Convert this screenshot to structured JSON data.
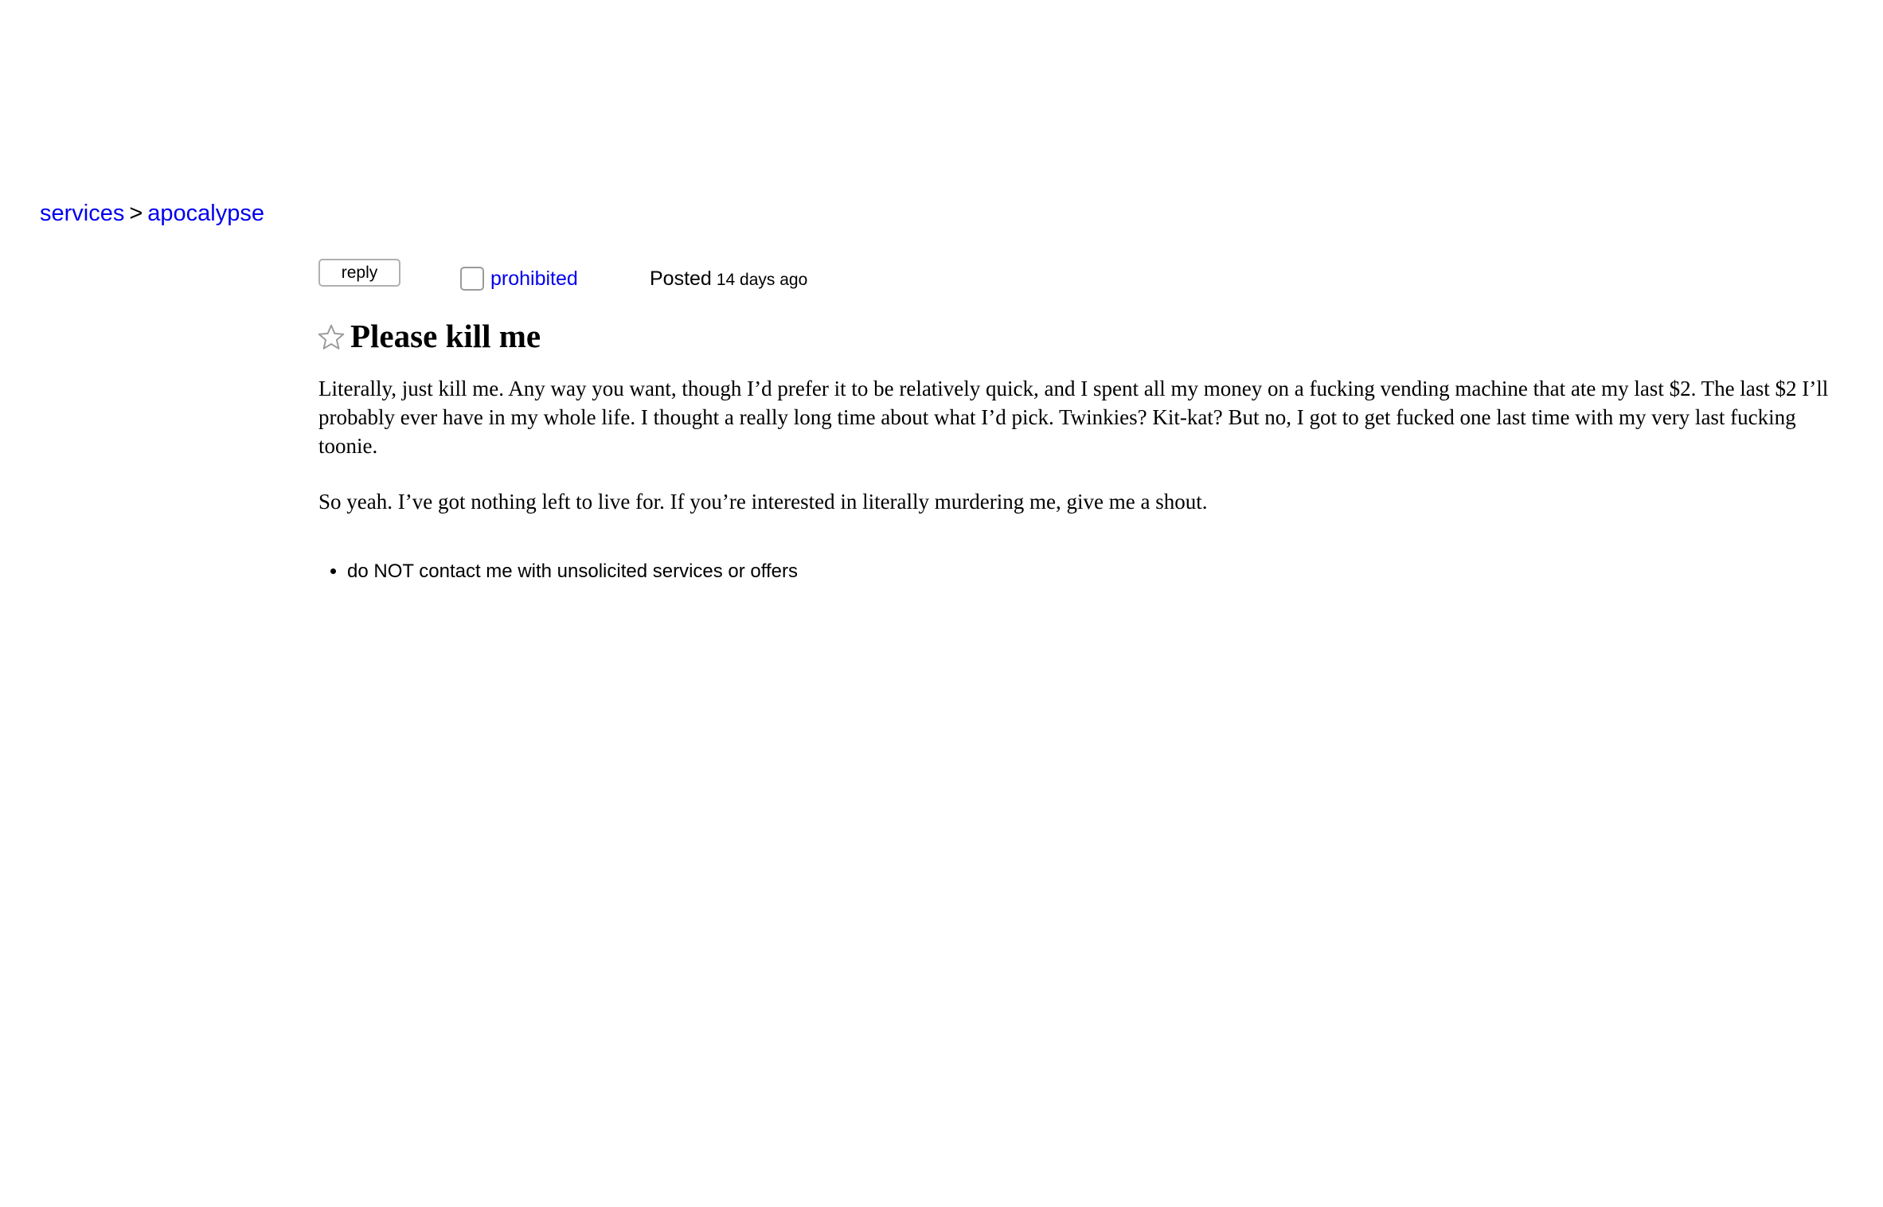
{
  "breadcrumb": {
    "category": "services",
    "separator": ">",
    "subcategory": "apocalypse"
  },
  "actions": {
    "reply_label": "reply",
    "flag_label": "prohibited"
  },
  "meta": {
    "posted_label": "Posted",
    "posted_ago": "14 days ago"
  },
  "post": {
    "title": "Please kill me",
    "paragraphs": [
      "Literally, just kill me. Any way you want, though I’d prefer it to be relatively quick, and I spent all my money on a fucking vending machine that ate my last $2. The last $2 I’ll probably ever have in my whole life. I thought a really long time about what I’d pick. Twinkies? Kit-kat? But no, I got to get fucked one last time with my very last fucking toonie.",
      "So yeah. I’ve got nothing left to live for. If you’re interested in literally murdering me, give me a shout."
    ]
  },
  "notices": [
    "do NOT contact me with unsolicited services or offers"
  ],
  "icons": {
    "favorite": "star-outline-icon",
    "flag": "checkbox-icon"
  }
}
